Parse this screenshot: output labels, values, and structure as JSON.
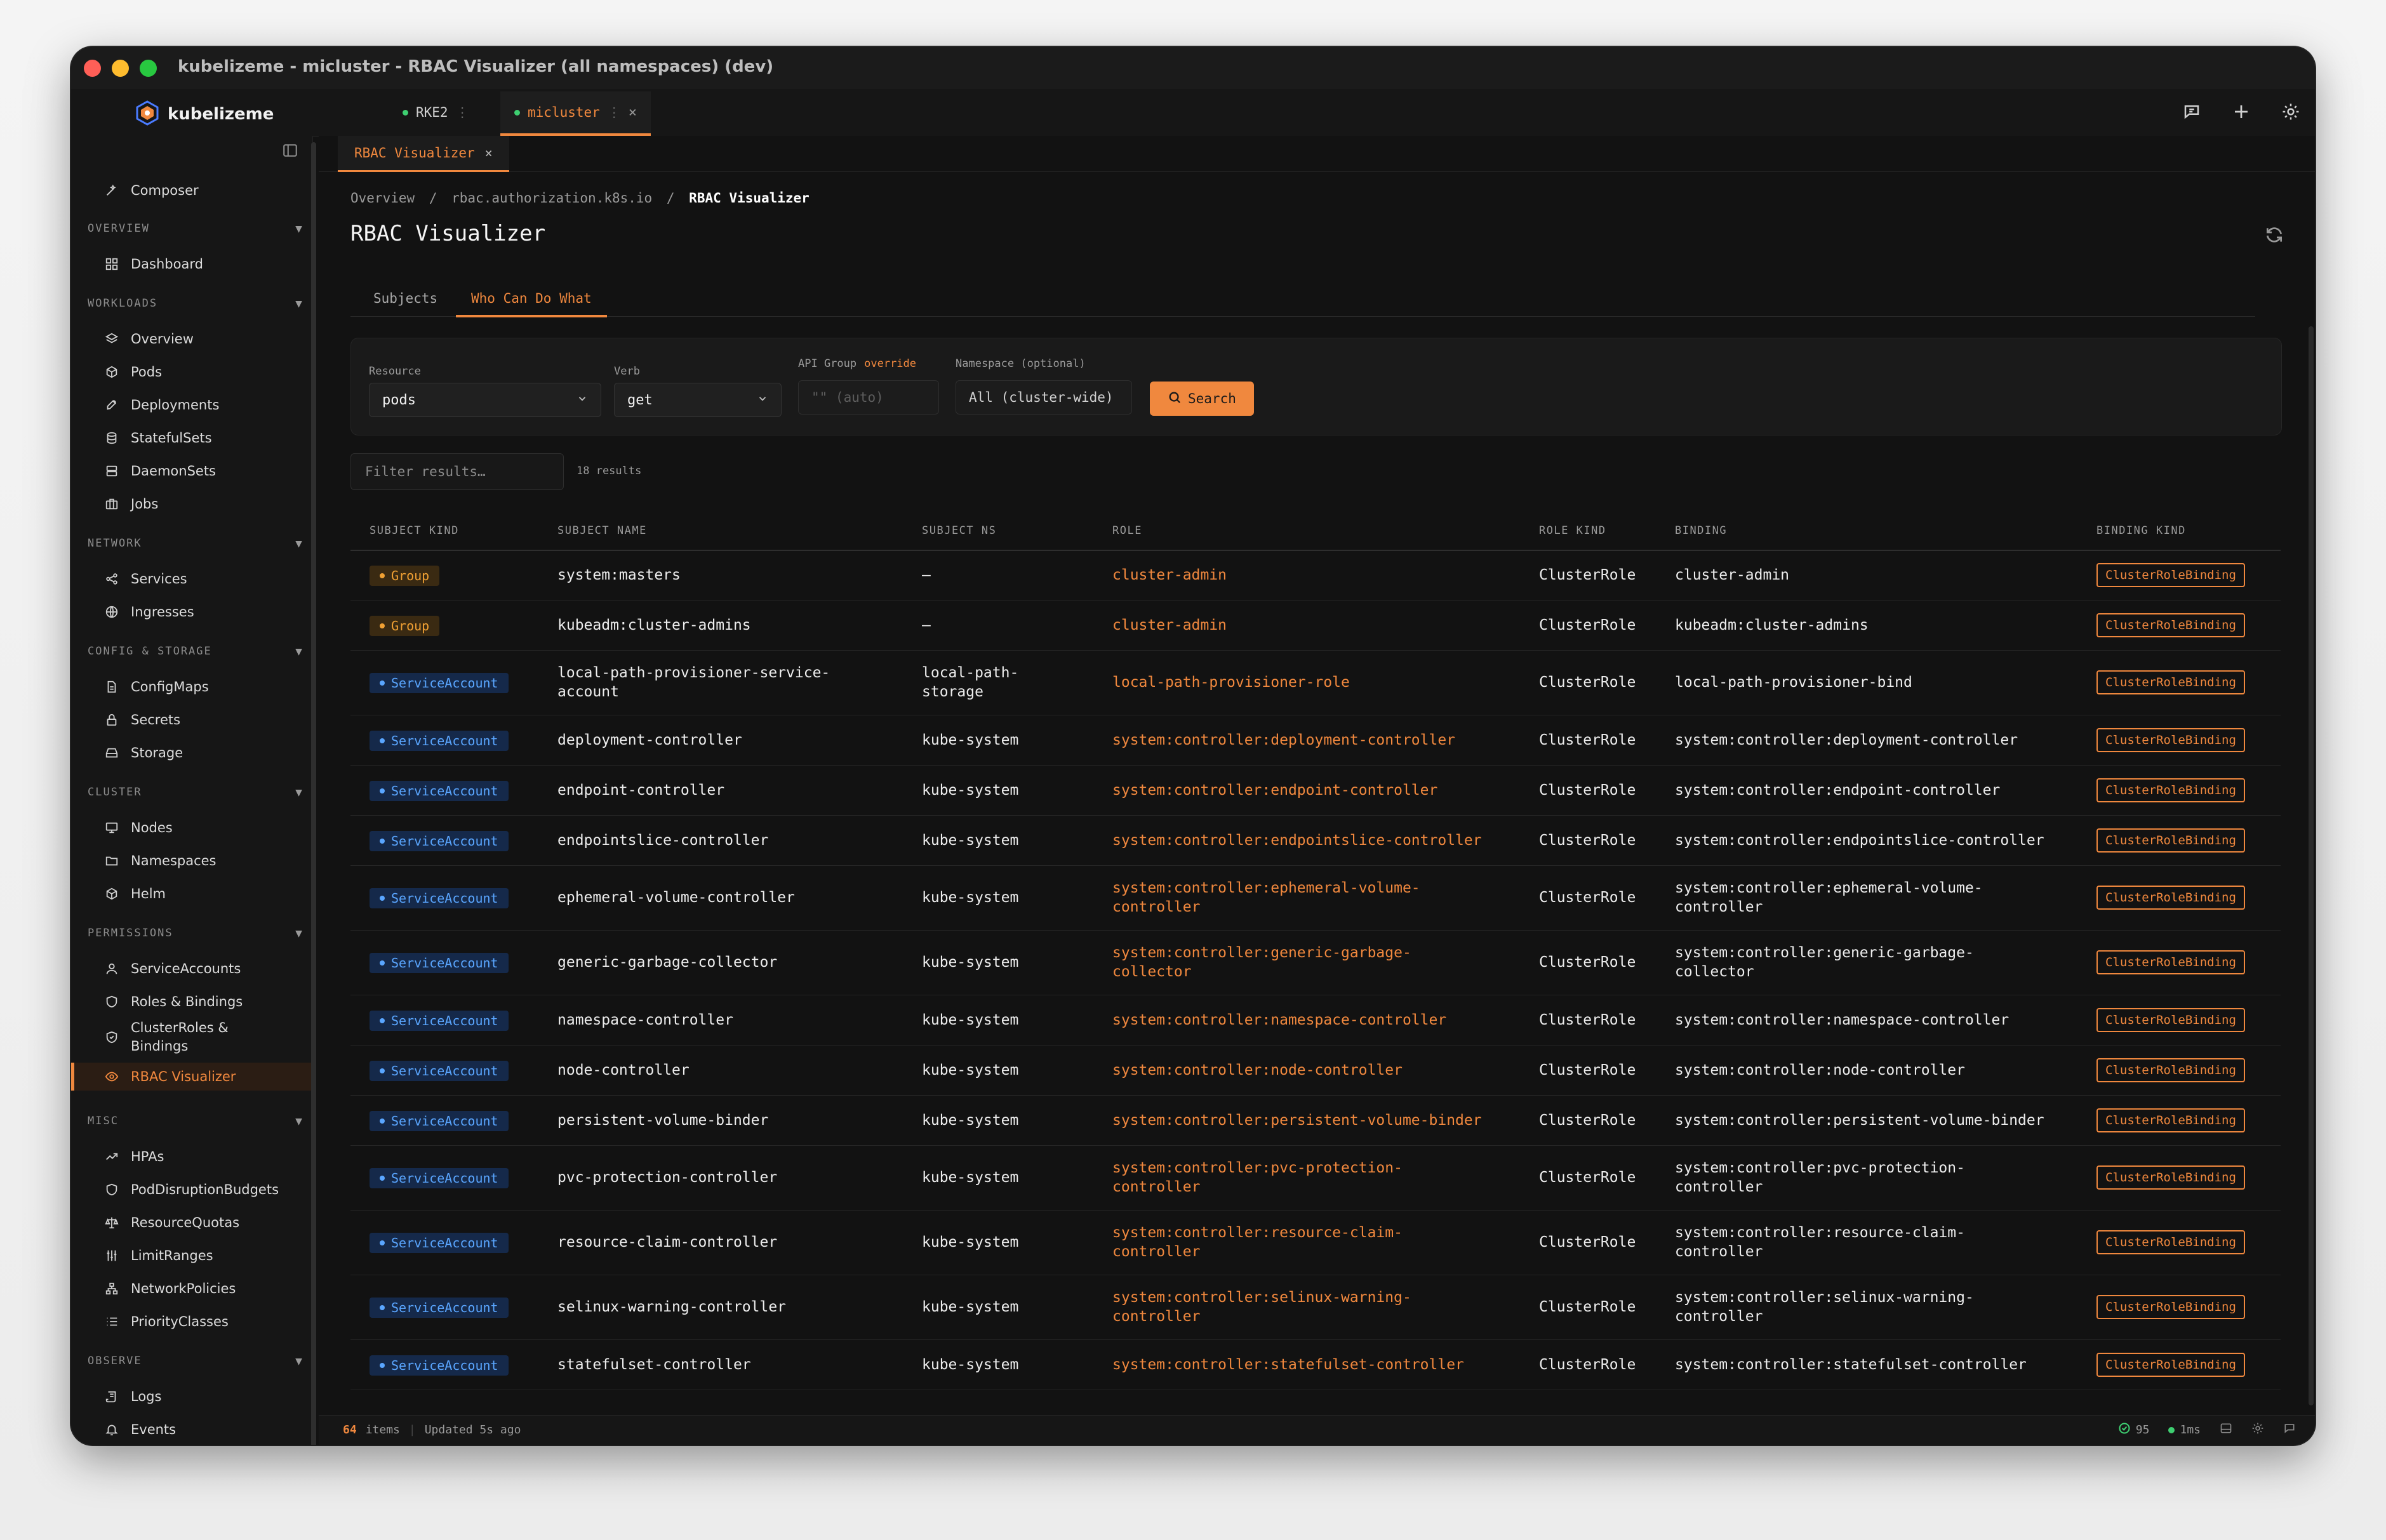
{
  "window": {
    "title": "kubelizeme - micluster - RBAC Visualizer (all namespaces) (dev)"
  },
  "brand": {
    "name": "kubelizeme"
  },
  "cluster_tabs": [
    {
      "label": "RKE2",
      "active": false
    },
    {
      "label": "micluster",
      "active": true
    }
  ],
  "sidebar": {
    "composer": "Composer",
    "sections": {
      "overview": "OVERVIEW",
      "workloads": "WORKLOADS",
      "network": "NETWORK",
      "config": "CONFIG & STORAGE",
      "cluster": "CLUSTER",
      "permissions": "PERMISSIONS",
      "misc": "MISC",
      "observe": "OBSERVE"
    },
    "items": {
      "dashboard": "Dashboard",
      "overview": "Overview",
      "pods": "Pods",
      "deployments": "Deployments",
      "statefulsets": "StatefulSets",
      "daemonsets": "DaemonSets",
      "jobs": "Jobs",
      "services": "Services",
      "ingresses": "Ingresses",
      "configmaps": "ConfigMaps",
      "secrets": "Secrets",
      "storage": "Storage",
      "nodes": "Nodes",
      "namespaces": "Namespaces",
      "helm": "Helm",
      "serviceaccounts": "ServiceAccounts",
      "roles": "Roles & Bindings",
      "clusterroles_1": "ClusterRoles &",
      "clusterroles_2": "Bindings",
      "rbac": "RBAC Visualizer",
      "hpas": "HPAs",
      "pdb": "PodDisruptionBudgets",
      "quotas": "ResourceQuotas",
      "limits": "LimitRanges",
      "netpol": "NetworkPolicies",
      "priority": "PriorityClasses",
      "logs": "Logs",
      "events": "Events"
    }
  },
  "subtab": {
    "label": "RBAC Visualizer"
  },
  "breadcrumb": {
    "overview": "Overview",
    "sep": "/",
    "group": "rbac.authorization.k8s.io",
    "current": "RBAC Visualizer"
  },
  "page_title": "RBAC Visualizer",
  "view_tabs": {
    "subjects": "Subjects",
    "who": "Who Can Do What"
  },
  "filters": {
    "resource_label": "Resource",
    "resource_value": "pods",
    "verb_label": "Verb",
    "verb_value": "get",
    "api_group_label": "API Group",
    "api_group_override": "override",
    "api_group_placeholder": "\"\" (auto)",
    "namespace_label": "Namespace (optional)",
    "namespace_value": "All (cluster-wide)",
    "search_label": "Search"
  },
  "results": {
    "filter_placeholder": "Filter results…",
    "count": "18 results"
  },
  "table": {
    "headers": [
      "SUBJECT KIND",
      "SUBJECT NAME",
      "SUBJECT NS",
      "ROLE",
      "ROLE KIND",
      "BINDING",
      "BINDING KIND"
    ],
    "rows": [
      {
        "kind": "Group",
        "name": "system:masters",
        "ns": "—",
        "role": "cluster-admin",
        "role_kind": "ClusterRole",
        "binding": "cluster-admin",
        "binding_kind": "ClusterRoleBinding"
      },
      {
        "kind": "Group",
        "name": "kubeadm:cluster-admins",
        "ns": "—",
        "role": "cluster-admin",
        "role_kind": "ClusterRole",
        "binding": "kubeadm:cluster-admins",
        "binding_kind": "ClusterRoleBinding"
      },
      {
        "kind": "ServiceAccount",
        "name": [
          "local-path-provisioner-service-",
          "account"
        ],
        "ns": [
          "local-path-",
          "storage"
        ],
        "role": "local-path-provisioner-role",
        "role_kind": "ClusterRole",
        "binding": "local-path-provisioner-bind",
        "binding_kind": "ClusterRoleBinding"
      },
      {
        "kind": "ServiceAccount",
        "name": "deployment-controller",
        "ns": "kube-system",
        "role": "system:controller:deployment-controller",
        "role_kind": "ClusterRole",
        "binding": "system:controller:deployment-controller",
        "binding_kind": "ClusterRoleBinding"
      },
      {
        "kind": "ServiceAccount",
        "name": "endpoint-controller",
        "ns": "kube-system",
        "role": "system:controller:endpoint-controller",
        "role_kind": "ClusterRole",
        "binding": "system:controller:endpoint-controller",
        "binding_kind": "ClusterRoleBinding"
      },
      {
        "kind": "ServiceAccount",
        "name": "endpointslice-controller",
        "ns": "kube-system",
        "role": "system:controller:endpointslice-controller",
        "role_kind": "ClusterRole",
        "binding": "system:controller:endpointslice-controller",
        "binding_kind": "ClusterRoleBinding"
      },
      {
        "kind": "ServiceAccount",
        "name": "ephemeral-volume-controller",
        "ns": "kube-system",
        "role": [
          "system:controller:ephemeral-volume-",
          "controller"
        ],
        "role_kind": "ClusterRole",
        "binding": [
          "system:controller:ephemeral-volume-",
          "controller"
        ],
        "binding_kind": "ClusterRoleBinding"
      },
      {
        "kind": "ServiceAccount",
        "name": "generic-garbage-collector",
        "ns": "kube-system",
        "role": [
          "system:controller:generic-garbage-",
          "collector"
        ],
        "role_kind": "ClusterRole",
        "binding": [
          "system:controller:generic-garbage-",
          "collector"
        ],
        "binding_kind": "ClusterRoleBinding"
      },
      {
        "kind": "ServiceAccount",
        "name": "namespace-controller",
        "ns": "kube-system",
        "role": "system:controller:namespace-controller",
        "role_kind": "ClusterRole",
        "binding": "system:controller:namespace-controller",
        "binding_kind": "ClusterRoleBinding"
      },
      {
        "kind": "ServiceAccount",
        "name": "node-controller",
        "ns": "kube-system",
        "role": "system:controller:node-controller",
        "role_kind": "ClusterRole",
        "binding": "system:controller:node-controller",
        "binding_kind": "ClusterRoleBinding"
      },
      {
        "kind": "ServiceAccount",
        "name": "persistent-volume-binder",
        "ns": "kube-system",
        "role": "system:controller:persistent-volume-binder",
        "role_kind": "ClusterRole",
        "binding": "system:controller:persistent-volume-binder",
        "binding_kind": "ClusterRoleBinding"
      },
      {
        "kind": "ServiceAccount",
        "name": "pvc-protection-controller",
        "ns": "kube-system",
        "role": [
          "system:controller:pvc-protection-",
          "controller"
        ],
        "role_kind": "ClusterRole",
        "binding": [
          "system:controller:pvc-protection-",
          "controller"
        ],
        "binding_kind": "ClusterRoleBinding"
      },
      {
        "kind": "ServiceAccount",
        "name": "resource-claim-controller",
        "ns": "kube-system",
        "role": [
          "system:controller:resource-claim-",
          "controller"
        ],
        "role_kind": "ClusterRole",
        "binding": [
          "system:controller:resource-claim-",
          "controller"
        ],
        "binding_kind": "ClusterRoleBinding"
      },
      {
        "kind": "ServiceAccount",
        "name": "selinux-warning-controller",
        "ns": "kube-system",
        "role": [
          "system:controller:selinux-warning-",
          "controller"
        ],
        "role_kind": "ClusterRole",
        "binding": [
          "system:controller:selinux-warning-",
          "controller"
        ],
        "binding_kind": "ClusterRoleBinding"
      },
      {
        "kind": "ServiceAccount",
        "name": "statefulset-controller",
        "ns": "kube-system",
        "role": "system:controller:statefulset-controller",
        "role_kind": "ClusterRole",
        "binding": "system:controller:statefulset-controller",
        "binding_kind": "ClusterRoleBinding"
      }
    ]
  },
  "statusbar": {
    "items_count": "64",
    "items_label": "items",
    "updated": "Updated 5s ago",
    "health": "95",
    "latency": "1ms"
  },
  "colors": {
    "accent": "#f0883e",
    "group": "#f0a033",
    "service_account": "#5aa6ff",
    "background": "#121212"
  }
}
